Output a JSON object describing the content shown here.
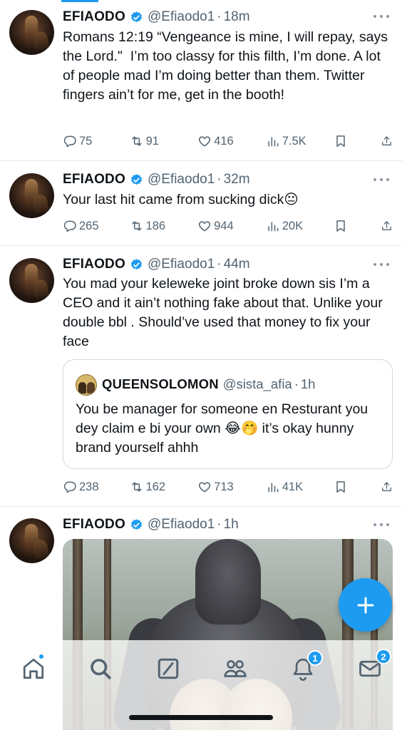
{
  "tweets": [
    {
      "name": "EFIAODO",
      "handle": "@Efiaodo1",
      "time": "18m",
      "text": "Romans 12:19 “Vengeance is mine, I will repay, says the Lord.\"  I’m too classy for this filth, I’m done. A lot of people mad I’m doing better than them. Twitter fingers ain’t for me, get in the booth!",
      "replies": "75",
      "reposts": "91",
      "likes": "416",
      "views": "7.5K"
    },
    {
      "name": "EFIAODO",
      "handle": "@Efiaodo1",
      "time": "32m",
      "text": "Your last hit came from sucking dick😐",
      "replies": "265",
      "reposts": "186",
      "likes": "944",
      "views": "20K"
    },
    {
      "name": "EFIAODO",
      "handle": "@Efiaodo1",
      "time": "44m",
      "text": "You mad your keleweke joint broke down sis I’m a CEO and it ain’t nothing fake about that. Unlike your double bbl . Should’ve used that money to fix your face",
      "replies": "238",
      "reposts": "162",
      "likes": "713",
      "views": "41K",
      "quote": {
        "name": "QUEENSOLOMON",
        "handle": "@sista_afia",
        "time": "1h",
        "text": "You be manager for someone en Resturant you dey claim e bi your own 😂🤭 it’s okay hunny brand yourself ahhh"
      }
    },
    {
      "name": "EFIAODO",
      "handle": "@Efiaodo1",
      "time": "1h"
    }
  ],
  "tabbar": {
    "notifications_badge": "1",
    "messages_badge": "2"
  },
  "colors": {
    "accent": "#1d9bf0",
    "secondary_text": "#536471"
  },
  "icons": [
    "reply-icon",
    "repost-icon",
    "like-icon",
    "views-icon",
    "bookmark-icon",
    "share-icon",
    "home-icon",
    "search-icon",
    "grok-icon",
    "communities-icon",
    "notifications-icon",
    "messages-icon",
    "compose-icon"
  ]
}
